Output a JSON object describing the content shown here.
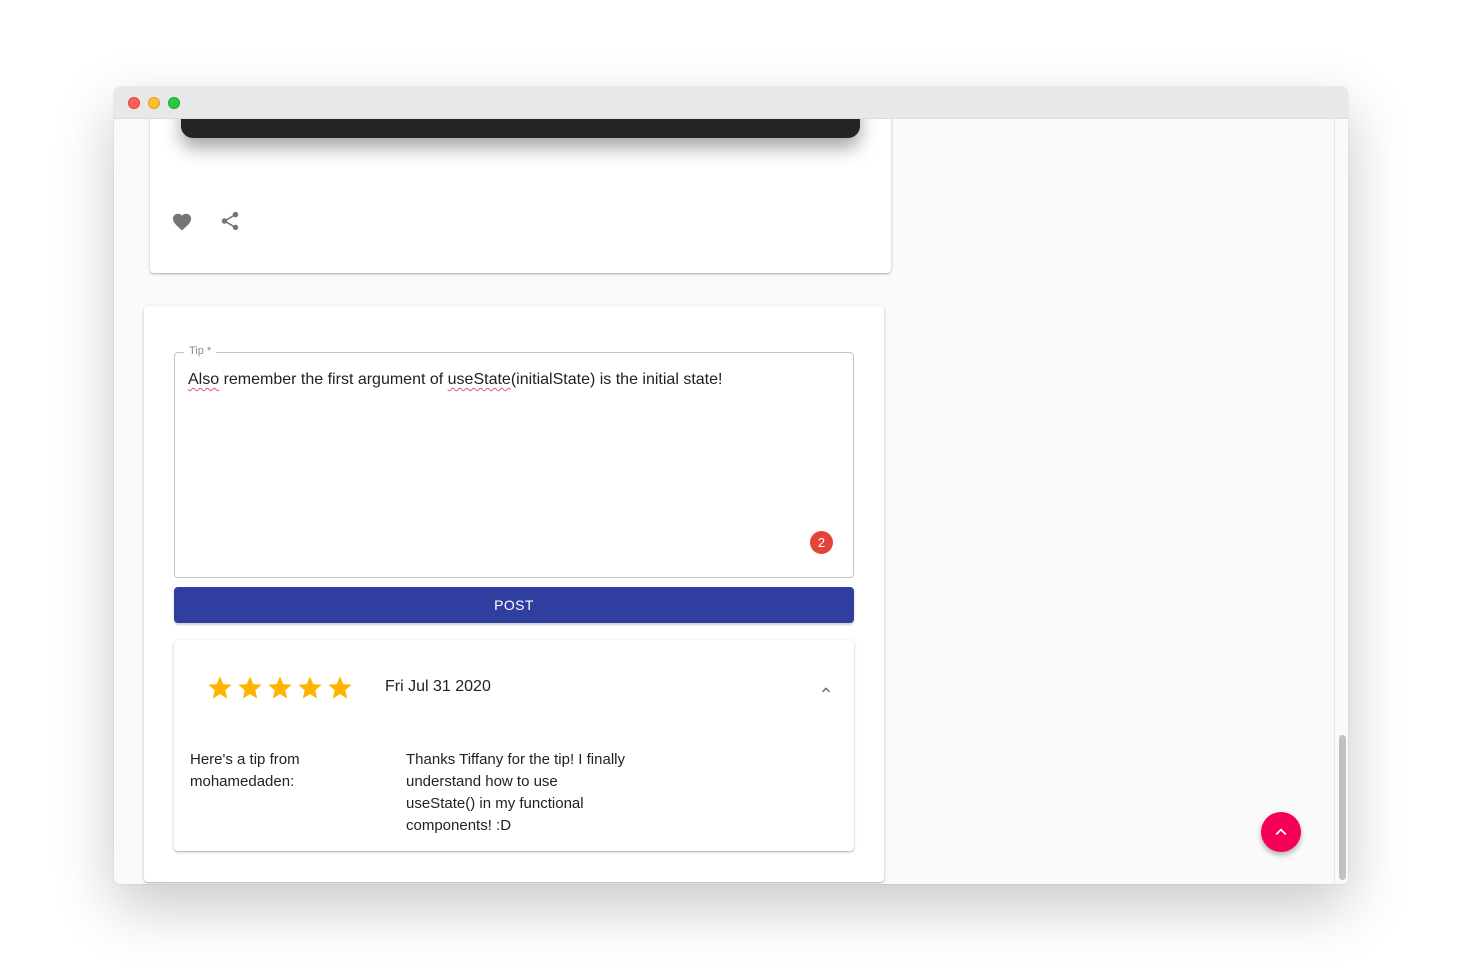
{
  "tip_form": {
    "label": "Tip *",
    "text_prefix": "Also",
    "text_mid1": " remember the first argument of ",
    "text_flag2": "useState",
    "text_rest": "(initialState) is the initial state!",
    "counter": "2",
    "post_label": "POST"
  },
  "review": {
    "rating": 5,
    "date": "Fri Jul 31 2020",
    "from": "Here's a tip from mohamedaden:",
    "body": "Thanks Tiffany for the tip! I finally understand how to use useState() in my functional components! :D"
  },
  "colors": {
    "post_button": "#303f9f",
    "star": "#ffb400",
    "fab": "#f50057",
    "badge": "#e2433a"
  },
  "icons": {
    "like": "heart-icon",
    "share": "share-icon",
    "collapse": "chevron-up-icon",
    "scroll_top": "chevron-up-icon"
  }
}
